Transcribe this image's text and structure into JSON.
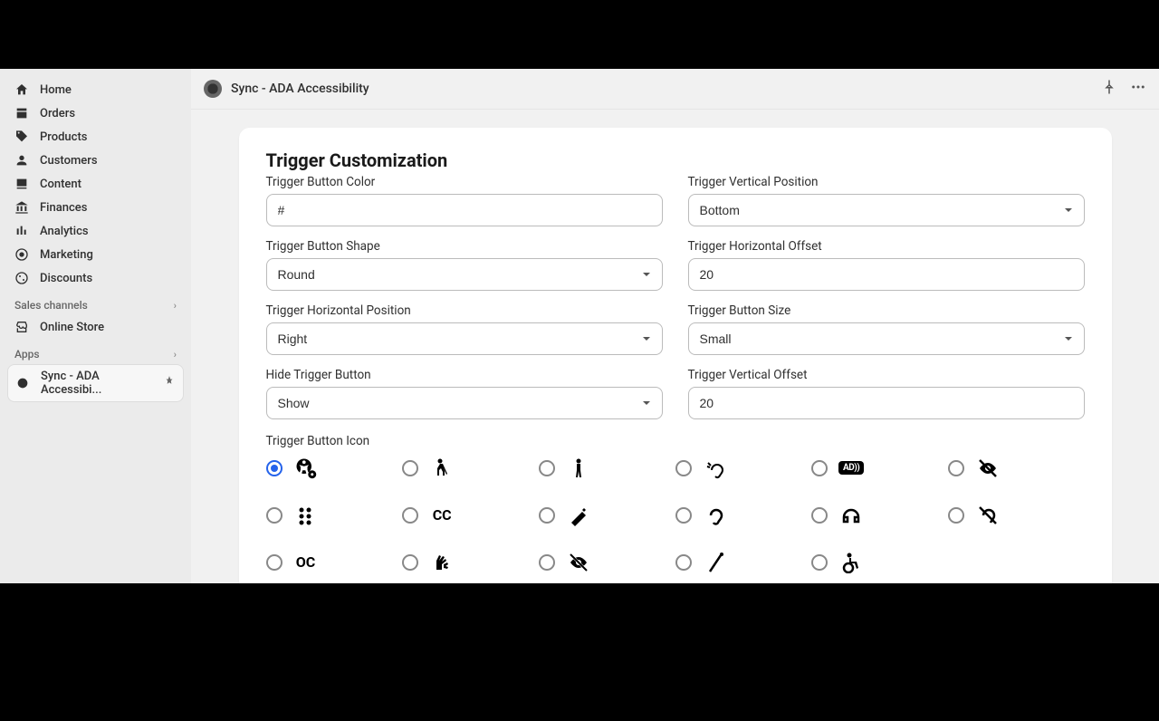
{
  "app_title": "Sync - ADA Accessibility",
  "sidebar": {
    "items": [
      {
        "label": "Home"
      },
      {
        "label": "Orders"
      },
      {
        "label": "Products"
      },
      {
        "label": "Customers"
      },
      {
        "label": "Content"
      },
      {
        "label": "Finances"
      },
      {
        "label": "Analytics"
      },
      {
        "label": "Marketing"
      },
      {
        "label": "Discounts"
      }
    ],
    "section_sales": "Sales channels",
    "online_store": "Online Store",
    "section_apps": "Apps",
    "active_app": "Sync - ADA Accessibi..."
  },
  "card": {
    "title": "Trigger Customization",
    "fields": {
      "color_label": "Trigger Button Color",
      "color_value": "#",
      "vpos_label": "Trigger Vertical Position",
      "vpos_value": "Bottom",
      "shape_label": "Trigger Button Shape",
      "shape_value": "Round",
      "hoff_label": "Trigger Horizontal Offset",
      "hoff_value": "20",
      "hpos_label": "Trigger Horizontal Position",
      "hpos_value": "Right",
      "size_label": "Trigger Button Size",
      "size_value": "Small",
      "hide_label": "Hide Trigger Button",
      "hide_value": "Show",
      "voff_label": "Trigger Vertical Offset",
      "voff_value": "20",
      "icon_label": "Trigger Button Icon"
    },
    "icons": [
      {
        "name": "universal-access-gear",
        "selected": true
      },
      {
        "name": "blind-walking"
      },
      {
        "name": "person-standing"
      },
      {
        "name": "assistive-listening"
      },
      {
        "name": "audio-description",
        "text": "AD))"
      },
      {
        "name": "low-vision-slash"
      },
      {
        "name": "braille-dots"
      },
      {
        "name": "closed-captions",
        "text": "CC"
      },
      {
        "name": "screen-reader"
      },
      {
        "name": "ear"
      },
      {
        "name": "headphones"
      },
      {
        "name": "deaf-slash"
      },
      {
        "name": "open-captions",
        "text": "OC"
      },
      {
        "name": "sign-language"
      },
      {
        "name": "eye-slash"
      },
      {
        "name": "cane"
      },
      {
        "name": "wheelchair"
      }
    ]
  }
}
